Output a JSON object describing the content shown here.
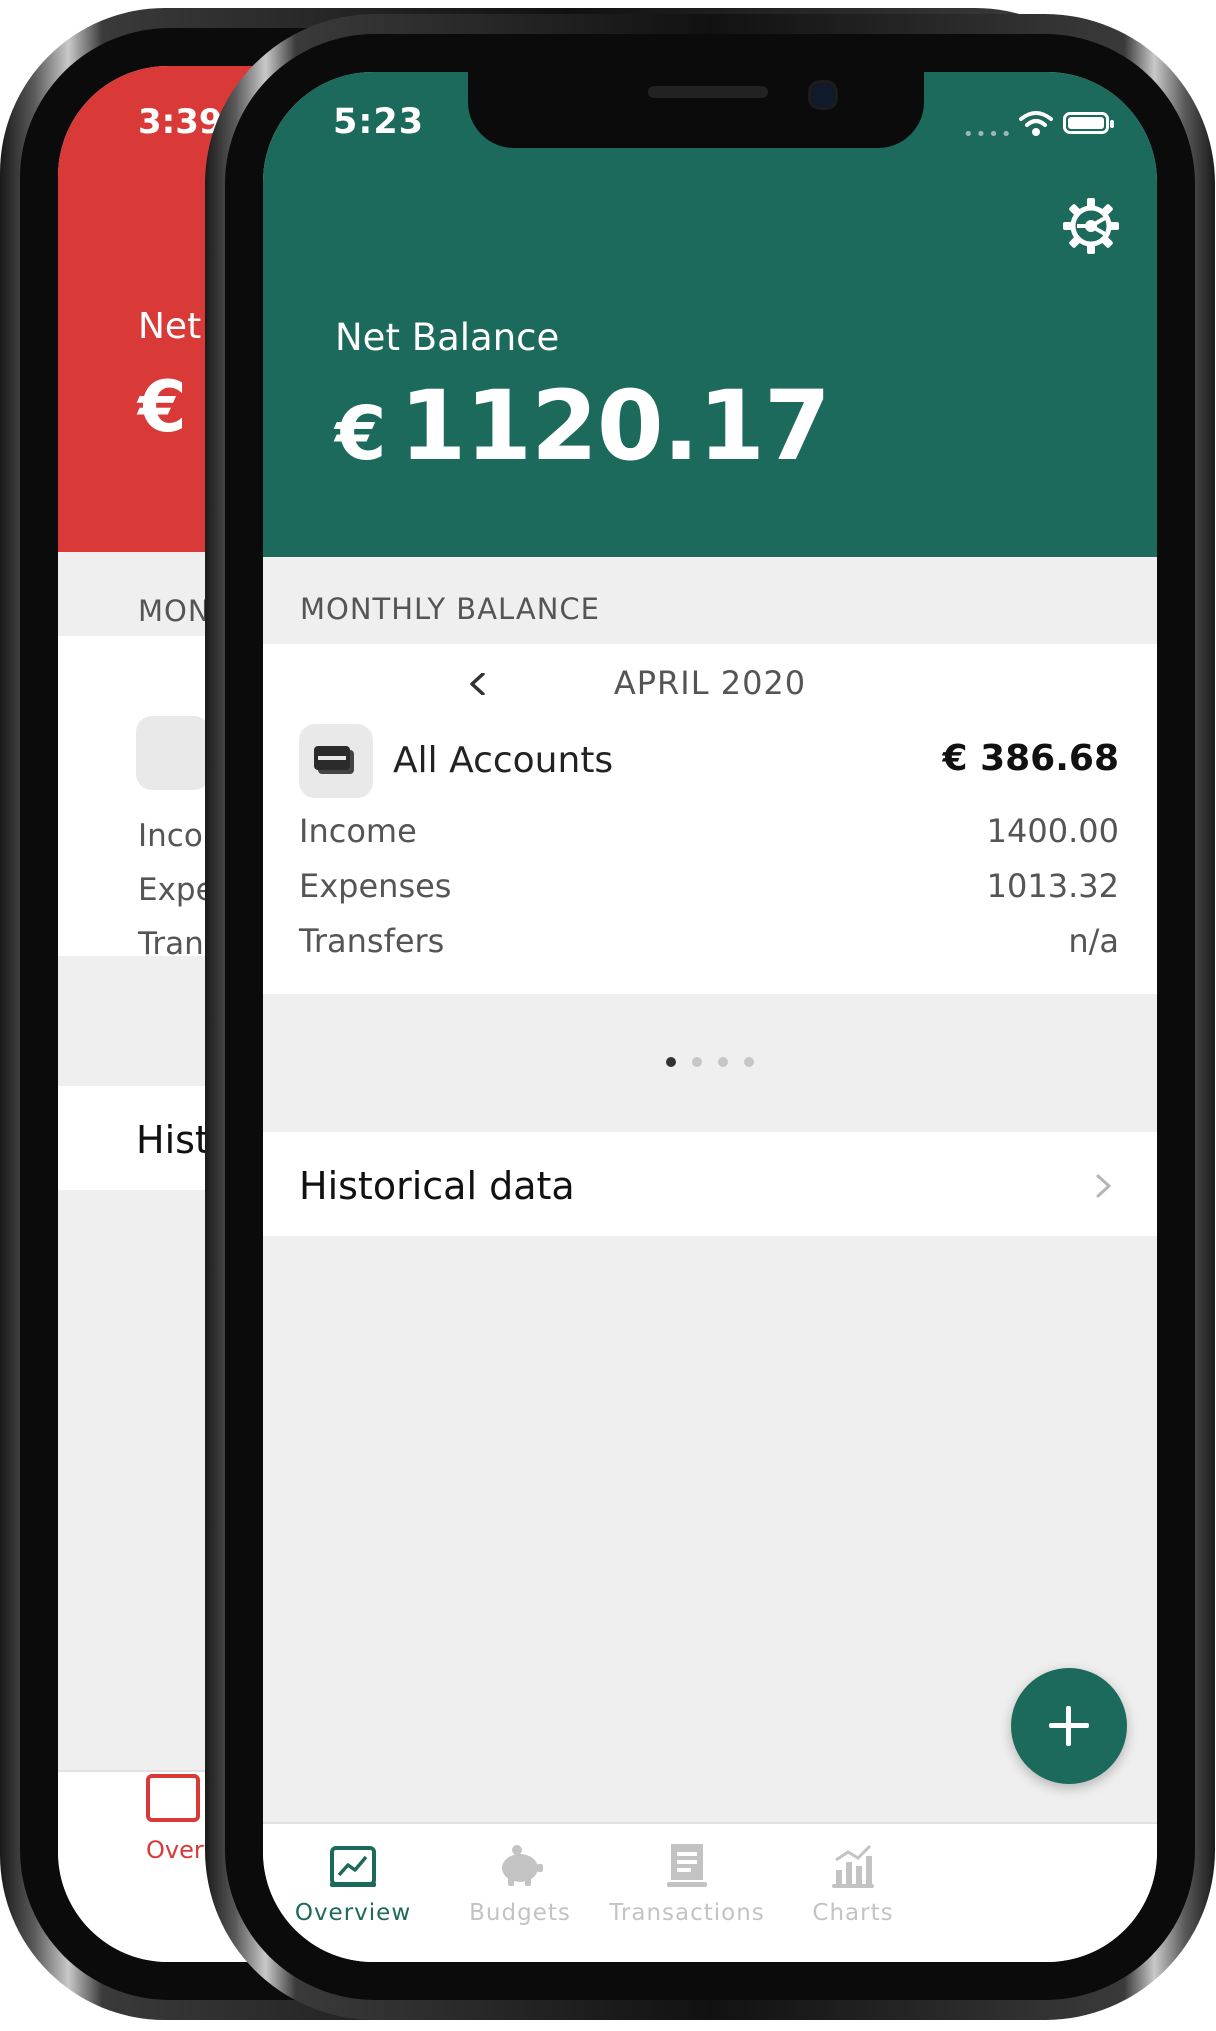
{
  "back_phone": {
    "status_time": "3:39",
    "net_label_partial": "Net",
    "euro_partial": "€",
    "month_partial": "MONTH",
    "rows_partial": [
      "Income",
      "Expens",
      "Transfe"
    ],
    "hist_partial": "Histor",
    "tab_partial": "Overvie",
    "accent": "#d93a37"
  },
  "status": {
    "time": "5:23"
  },
  "header": {
    "title": "Net Balance",
    "currency": "€",
    "amount": "1120.17",
    "accent": "#1c6a5b"
  },
  "monthly": {
    "section_title": "MONTHLY BALANCE",
    "month": "APRIL 2020",
    "account_name": "All Accounts",
    "account_total": "€ 386.68",
    "rows": [
      {
        "label": "Income",
        "value": "1400.00"
      },
      {
        "label": "Expenses",
        "value": "1013.32"
      },
      {
        "label": "Transfers",
        "value": "n/a"
      }
    ],
    "page_count": 4,
    "active_page": 0
  },
  "historical": {
    "label": "Historical data"
  },
  "tabs": [
    {
      "label": "Overview",
      "icon": "overview-icon",
      "active": true
    },
    {
      "label": "Budgets",
      "icon": "piggy-bank-icon",
      "active": false
    },
    {
      "label": "Transactions",
      "icon": "receipt-icon",
      "active": false
    },
    {
      "label": "Charts",
      "icon": "bar-chart-icon",
      "active": false
    }
  ],
  "colors": {
    "active_tab": "#1c6a5b",
    "inactive_tab": "#c3c3c3"
  }
}
